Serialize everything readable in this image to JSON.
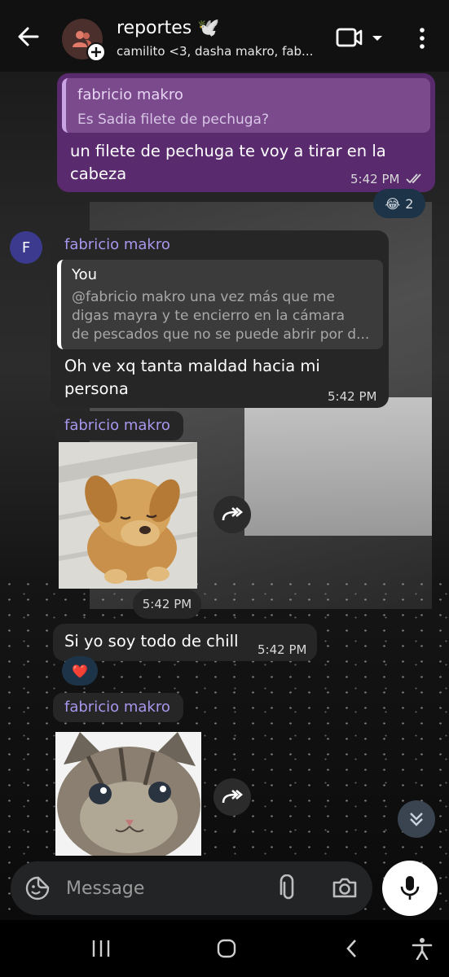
{
  "header": {
    "title": "reportes 🕊️",
    "subtitle": "camilito <3, dasha makro, fab..."
  },
  "composer": {
    "placeholder": "Message"
  },
  "messages": {
    "m1": {
      "quote_name": "fabricio makro",
      "quote_text": "Es Sadia filete de pechuga?",
      "line1": "un filete de pechuga te voy a tirar en la",
      "line2": "cabeza",
      "time": "5:42 PM",
      "reaction_emoji": "😂",
      "reaction_count": "2"
    },
    "m2": {
      "avatar_letter": "F",
      "sender": "fabricio makro",
      "quote_name": "You",
      "quote_line1": "@fabricio makro una vez más que me",
      "quote_line2": "digas mayra y te encierro en la cámara",
      "quote_line3": "de pescados que no se puede abrir por d...",
      "line1": "Oh ve xq tanta maldad hacia mi",
      "line2": "persona",
      "time": "5:42 PM"
    },
    "m3": {
      "sender": "fabricio makro",
      "time": "5:42 PM"
    },
    "m4": {
      "text": "Si yo soy todo de chill",
      "time": "5:42 PM",
      "reaction_emoji": "❤️"
    },
    "m5": {
      "sender": "fabricio makro"
    }
  },
  "colors": {
    "outgoing_bubble": "#5a2a6e",
    "incoming_bubble": "#262626",
    "sender_name": "#a996ee",
    "header_bg": "#111111"
  }
}
